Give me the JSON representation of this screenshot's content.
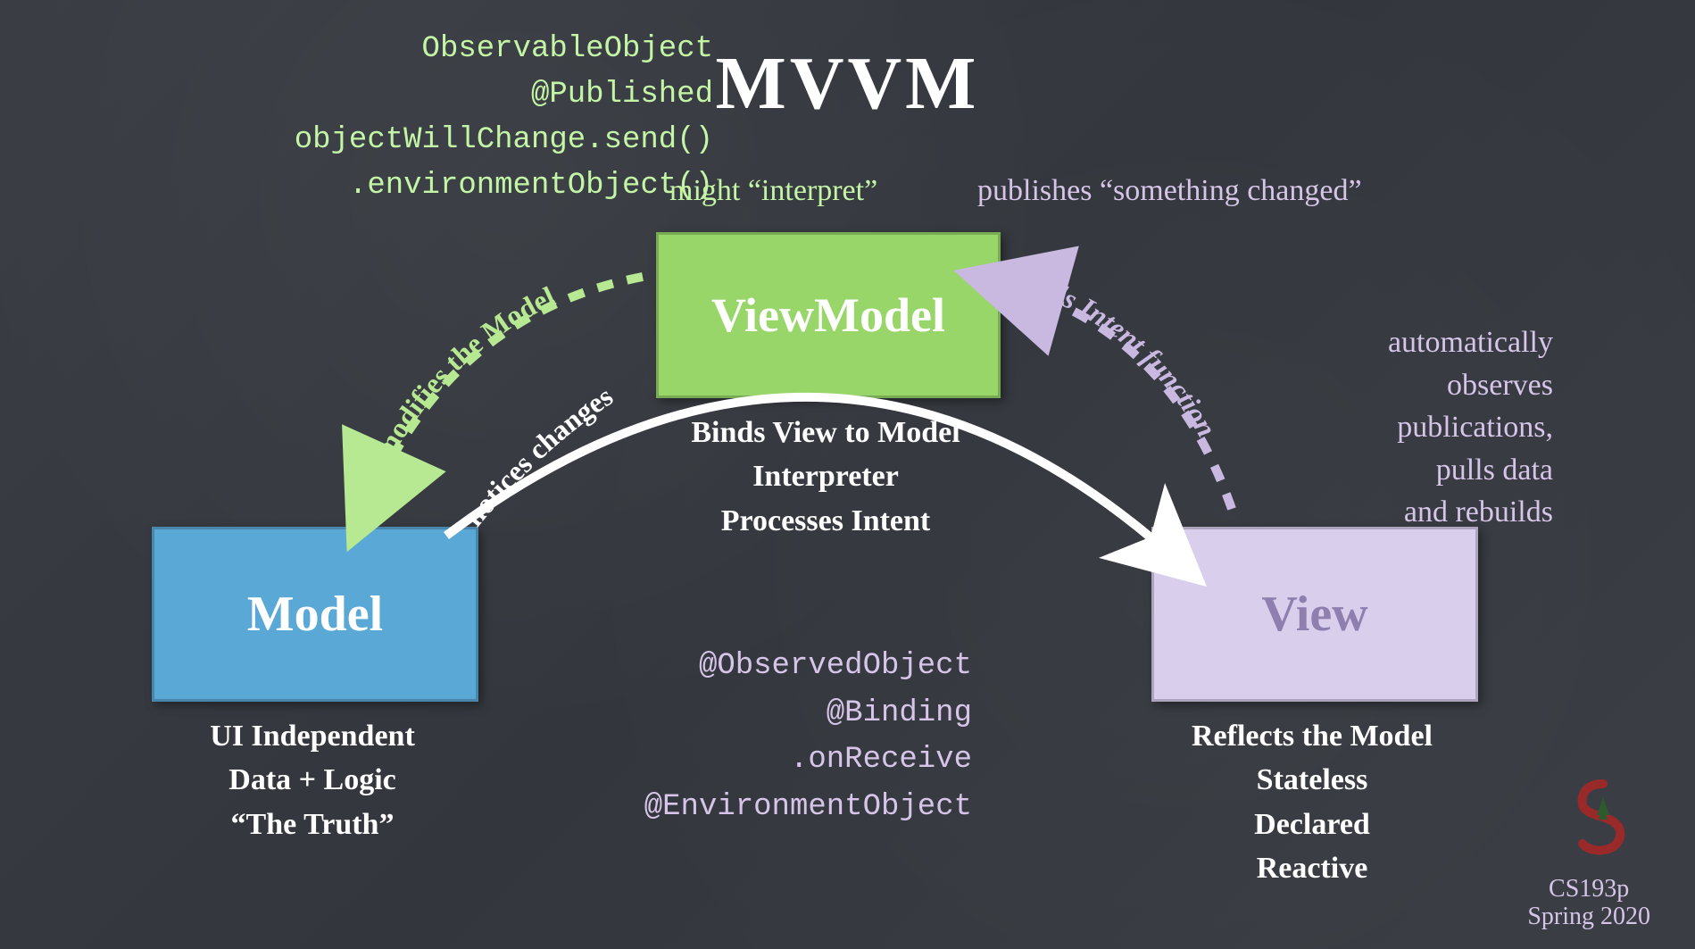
{
  "title": "MVVM",
  "code_keywords": {
    "vm": [
      "ObservableObject",
      "@Published",
      "objectWillChange.send()",
      ".environmentObject()"
    ],
    "view": [
      "@ObservedObject",
      "@Binding",
      ".onReceive",
      "@EnvironmentObject"
    ]
  },
  "annotations": {
    "vm_left": "might “interpret”",
    "vm_right": "publishes “something changed”",
    "right_note_l1": "automatically",
    "right_note_l2": "observes",
    "right_note_l3": "publications,",
    "right_note_l4": "pulls data",
    "right_note_l5": "and rebuilds"
  },
  "boxes": {
    "viewmodel": {
      "label": "ViewModel",
      "sub": [
        "Binds View to Model",
        "Interpreter",
        "Processes Intent"
      ]
    },
    "model": {
      "label": "Model",
      "sub": [
        "UI Independent",
        "Data + Logic",
        "“The Truth”"
      ]
    },
    "view": {
      "label": "View",
      "sub": [
        "Reflects the Model",
        "Stateless",
        "Declared",
        "Reactive"
      ]
    }
  },
  "arrows": {
    "notices_changes": "notices changes",
    "modifies_model": "modifies the Model",
    "calls_intent": "calls Intent function"
  },
  "footer": {
    "course": "CS193p",
    "term": "Spring 2020"
  }
}
